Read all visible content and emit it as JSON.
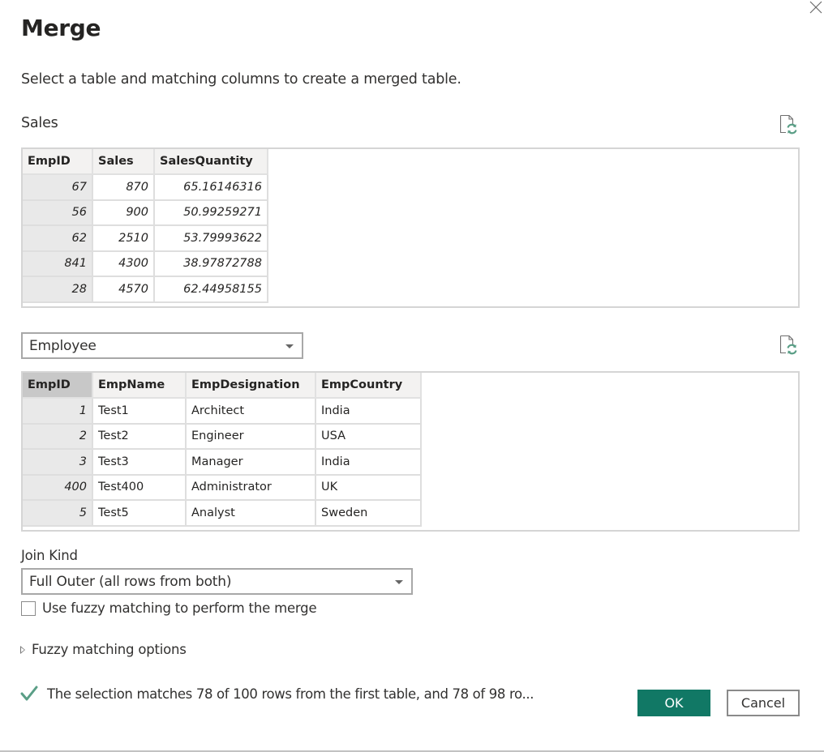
{
  "dialog": {
    "title": "Merge",
    "subtitle": "Select a table and matching columns to create a merged table.",
    "close_icon": "close-icon"
  },
  "first_table": {
    "name": "Sales",
    "refresh_icon": "document-refresh-icon",
    "columns": [
      "EmpID",
      "Sales",
      "SalesQuantity"
    ],
    "rows": [
      [
        "67",
        "870",
        "65.16146316"
      ],
      [
        "56",
        "900",
        "50.99259271"
      ],
      [
        "62",
        "2510",
        "53.79993622"
      ],
      [
        "841",
        "4300",
        "38.97872788"
      ],
      [
        "28",
        "4570",
        "62.44958155"
      ]
    ]
  },
  "second_table": {
    "selected": "Employee",
    "refresh_icon": "document-refresh-icon",
    "selected_column": "EmpID",
    "columns": [
      "EmpID",
      "EmpName",
      "EmpDesignation",
      "EmpCountry"
    ],
    "rows": [
      [
        "1",
        "Test1",
        "Architect",
        "India"
      ],
      [
        "2",
        "Test2",
        "Engineer",
        "USA"
      ],
      [
        "3",
        "Test3",
        "Manager",
        "India"
      ],
      [
        "400",
        "Test400",
        "Administrator",
        "UK"
      ],
      [
        "5",
        "Test5",
        "Analyst",
        "Sweden"
      ]
    ]
  },
  "join_kind": {
    "label": "Join Kind",
    "selected": "Full Outer (all rows from both)"
  },
  "fuzzy": {
    "checkbox_label": "Use fuzzy matching to perform the merge",
    "checked": false,
    "options_label": "Fuzzy matching options"
  },
  "status": {
    "icon": "checkmark-icon",
    "text": "The selection matches 78 of 100 rows from the first table, and 78 of 98 ro..."
  },
  "buttons": {
    "ok": "OK",
    "cancel": "Cancel"
  },
  "colors": {
    "accent": "#117865",
    "check": "#5a9e86"
  }
}
